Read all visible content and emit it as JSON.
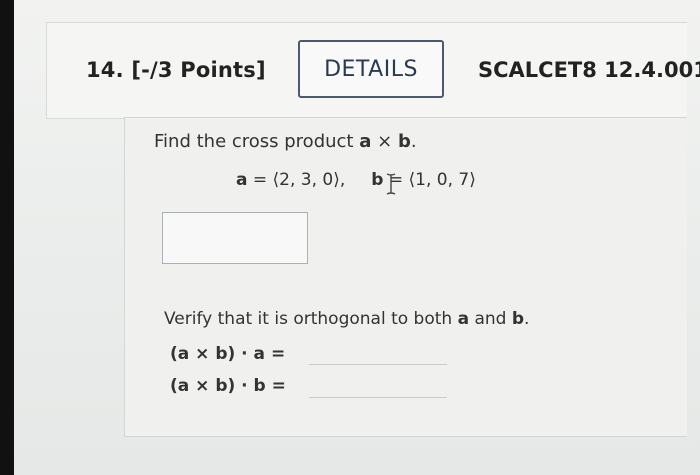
{
  "header": {
    "question_number": "14.",
    "points": "[-/3 Points]",
    "details_label": "DETAILS",
    "course_code": "SCALCET8 12.4.001."
  },
  "question": {
    "prompt_prefix": "Find the cross product ",
    "a": "a",
    "times": "×",
    "b": "b",
    "period": ".",
    "vector_a_value": " = ⟨2, 3, 0⟩,",
    "vector_b_value": " = ⟨1, 0, 7⟩",
    "verify_prefix": "Verify that it is orthogonal to both ",
    "verify_and": " and ",
    "row1_label": "(a × b) · a =",
    "row2_label": "(a × b) · b ="
  },
  "answers": {
    "cross_product": "",
    "dot_a": "",
    "dot_b": ""
  }
}
